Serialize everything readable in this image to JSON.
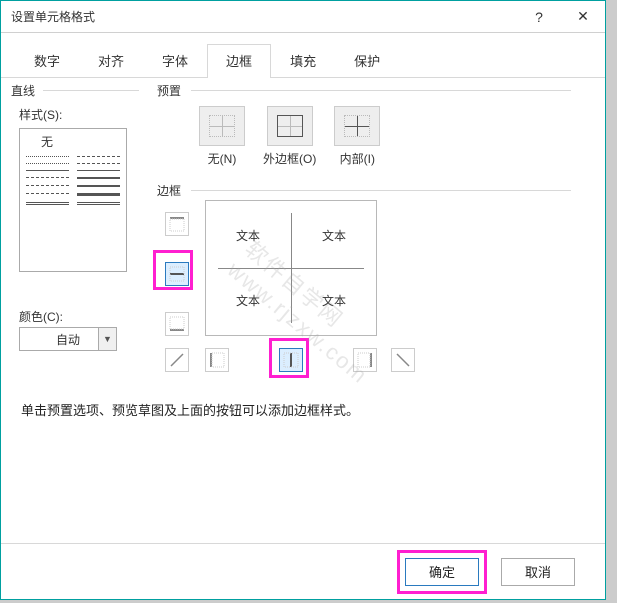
{
  "window": {
    "title": "设置单元格格式",
    "help": "?",
    "close": "✕"
  },
  "tabs": [
    "数字",
    "对齐",
    "字体",
    "边框",
    "填充",
    "保护"
  ],
  "active_tab": 3,
  "line_group": "直线",
  "style_label": "样式(S):",
  "style_none": "无",
  "color_label": "颜色(C):",
  "color_value": "自动",
  "preset_group": "预置",
  "presets": [
    {
      "label": "无(N)"
    },
    {
      "label": "外边框(O)"
    },
    {
      "label": "内部(I)"
    }
  ],
  "border_group": "边框",
  "preview_text": [
    "文本",
    "文本",
    "文本",
    "文本"
  ],
  "hint": "单击预置选项、预览草图及上面的按钮可以添加边框样式。",
  "buttons": {
    "ok": "确定",
    "cancel": "取消"
  }
}
